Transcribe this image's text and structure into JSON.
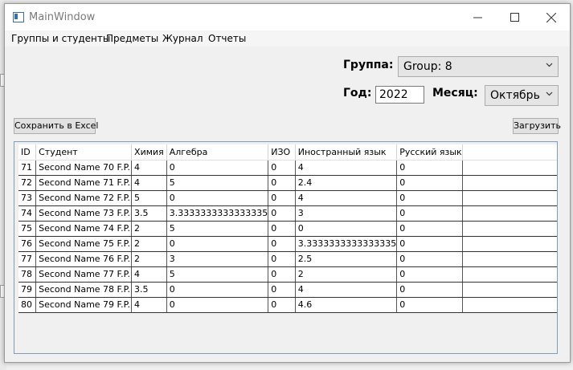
{
  "window": {
    "title": "MainWindow"
  },
  "menu": {
    "items": [
      "Группы и студенты",
      "Предметы",
      "Журнал",
      "Отчеты"
    ]
  },
  "filters": {
    "group_label": "Группа:",
    "group_value": "Group: 8",
    "year_label": "Год:",
    "year_value": "2022",
    "month_label": "Месяц:",
    "month_value": "Октябрь"
  },
  "buttons": {
    "save_excel": "Сохранить в Excel",
    "load": "Загрузить"
  },
  "grid": {
    "columns": [
      "ID",
      "Студент",
      "Химия",
      "Алгебра",
      "ИЗО",
      "Иностранный язык",
      "Русский язык"
    ],
    "rows": [
      [
        "71",
        "Second Name 70 F.P.",
        "4",
        "0",
        "0",
        "4",
        "0"
      ],
      [
        "72",
        "Second Name 71 F.P.",
        "4",
        "5",
        "0",
        "2.4",
        "0"
      ],
      [
        "73",
        "Second Name 72 F.P.",
        "5",
        "0",
        "0",
        "4",
        "0"
      ],
      [
        "74",
        "Second Name 73 F.P.",
        "3.5",
        "3.3333333333333335",
        "0",
        "3",
        "0"
      ],
      [
        "75",
        "Second Name 74 F.P.",
        "2",
        "5",
        "0",
        "0",
        "0"
      ],
      [
        "76",
        "Second Name 75 F.P.",
        "2",
        "0",
        "0",
        "3.3333333333333335",
        "0"
      ],
      [
        "77",
        "Second Name 76 F.P.",
        "2",
        "3",
        "0",
        "2.5",
        "0"
      ],
      [
        "78",
        "Second Name 77 F.P.",
        "4",
        "5",
        "0",
        "2",
        "0"
      ],
      [
        "79",
        "Second Name 78 F.P.",
        "3.5",
        "0",
        "0",
        "4",
        "0"
      ],
      [
        "80",
        "Second Name 79 F.P.",
        "4",
        "0",
        "0",
        "4.6",
        "0"
      ]
    ]
  }
}
